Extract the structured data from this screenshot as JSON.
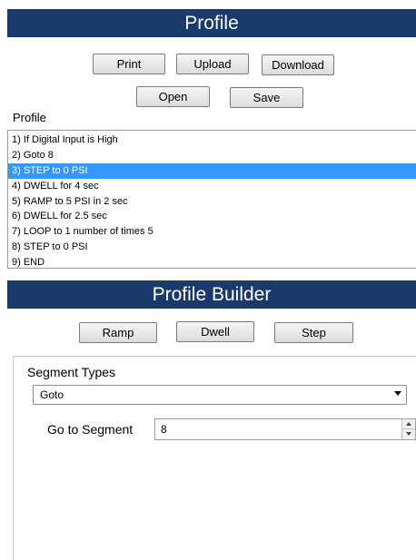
{
  "profile_header": {
    "title": "Profile"
  },
  "profile_buttons": {
    "print": "Print",
    "upload": "Upload",
    "download": "Download",
    "open": "Open",
    "save": "Save"
  },
  "profile_list": {
    "label": "Profile",
    "items": [
      "1) If Digital Input is High",
      "2) Goto 8",
      "3) STEP to 0 PSI",
      "4) DWELL for 4 sec",
      "5) RAMP to 5 PSI in 2 sec",
      "6) DWELL for 2.5 sec",
      "7) LOOP to 1 number of times 5",
      "8) STEP to 0 PSI",
      "9) END"
    ],
    "selected_index": 2
  },
  "builder_header": {
    "title": "Profile Builder"
  },
  "builder_buttons": {
    "ramp": "Ramp",
    "dwell": "Dwell",
    "step": "Step"
  },
  "segment": {
    "types_label": "Segment Types",
    "selected_type": "Goto",
    "goto_label": "Go to Segment",
    "goto_value": "8"
  },
  "colors": {
    "header_bg": "#1a3a6b",
    "selection": "#3399ff"
  }
}
